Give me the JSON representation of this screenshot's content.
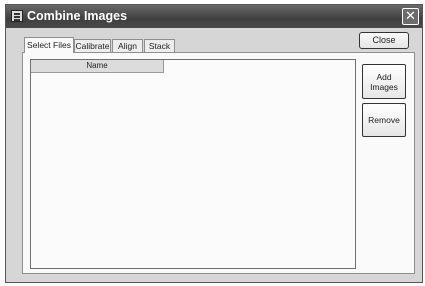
{
  "window": {
    "title": "Combine Images",
    "close_glyph": "✕",
    "icon": "app-window-icon"
  },
  "toolbar": {
    "close_label": "Close"
  },
  "tabs": [
    {
      "label": "Select Files",
      "active": true
    },
    {
      "label": "Calibrate",
      "active": false
    },
    {
      "label": "Align",
      "active": false
    },
    {
      "label": "Stack",
      "active": false
    }
  ],
  "file_list": {
    "columns": [
      "Name"
    ],
    "rows": []
  },
  "actions": {
    "add_line1": "Add",
    "add_line2": "Images",
    "remove_label": "Remove"
  }
}
